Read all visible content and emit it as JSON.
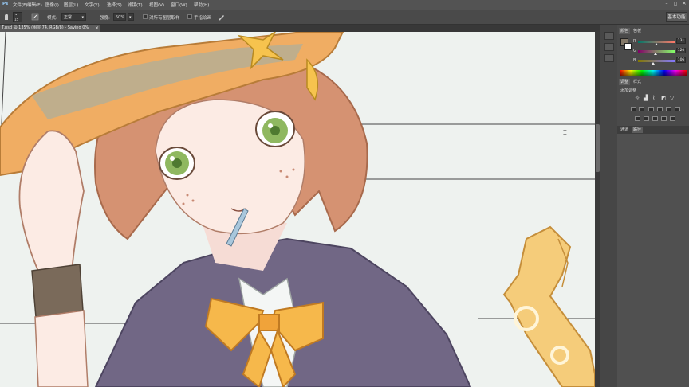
{
  "menubar": {
    "logo": "Ps",
    "items": [
      "文件(F)",
      "编辑(E)",
      "图像(I)",
      "图层(L)",
      "文字(Y)",
      "选择(S)",
      "滤镜(T)",
      "视图(V)",
      "窗口(W)",
      "帮助(H)"
    ],
    "controls": [
      "–",
      "◻",
      "✕"
    ]
  },
  "options_bar": {
    "brush_size": "15",
    "mode_label": "模式:",
    "mode_value": "正常",
    "strength_label": "强度:",
    "strength_value": "50%",
    "sample_all_label": "对所有图层取样",
    "finger_paint_label": "手指绘画",
    "workspace_button": "基本功能"
  },
  "document": {
    "tab_title": "T.psd @ 135% (图层 74, RGB/8) - Saving 0%",
    "tab_close": "×"
  },
  "panels": {
    "color_tab": "颜色",
    "swatches_tab": "色板",
    "rgb": [
      {
        "label": "R",
        "value": "131",
        "gradient": "linear-gradient(to right,#007868,#ff7868)",
        "pos": 0.51
      },
      {
        "label": "G",
        "value": "120",
        "gradient": "linear-gradient(to right,#830068,#83ff68)",
        "pos": 0.47
      },
      {
        "label": "B",
        "value": "106",
        "gradient": "linear-gradient(to right,#837800,#8378ff)",
        "pos": 0.42
      }
    ],
    "fg_color": "#837868",
    "adjust_tab": "调整",
    "styles_tab": "样式",
    "adjust_title": "添加调整",
    "channels_tab": "通道",
    "paths_tab": "路径"
  },
  "colors": {
    "canvas_bg": "#eef2ef",
    "hat": "#f0ad63",
    "hair": "#d59272",
    "skin": "#fcebe4",
    "cape": "#716785",
    "bow": "#f6b84b",
    "eyes": "#8fb860"
  }
}
